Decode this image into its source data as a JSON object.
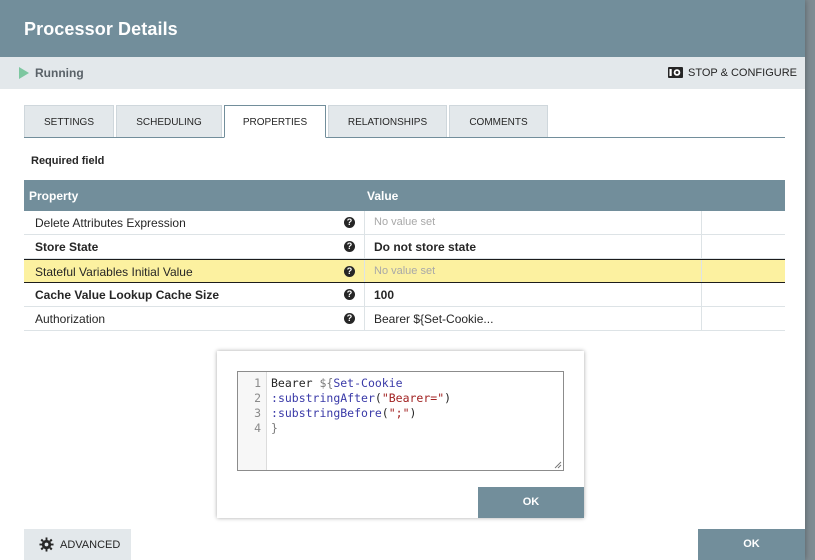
{
  "dialog": {
    "title": "Processor Details"
  },
  "status": {
    "state": "Running",
    "stop_configure_label": "STOP & CONFIGURE"
  },
  "tabs": [
    {
      "label": "SETTINGS",
      "active": false
    },
    {
      "label": "SCHEDULING",
      "active": false
    },
    {
      "label": "PROPERTIES",
      "active": true
    },
    {
      "label": "RELATIONSHIPS",
      "active": false
    },
    {
      "label": "COMMENTS",
      "active": false
    }
  ],
  "required_label": "Required field",
  "grid": {
    "headers": {
      "property": "Property",
      "value": "Value"
    },
    "rows": [
      {
        "name": "Delete Attributes Expression",
        "value": "No value set",
        "required": false,
        "placeholder": true
      },
      {
        "name": "Store State",
        "value": "Do not store state",
        "required": true,
        "placeholder": false
      },
      {
        "name": "Stateful Variables Initial Value",
        "value": "No value set",
        "required": false,
        "placeholder": true,
        "highlighted": true
      },
      {
        "name": "Cache Value Lookup Cache Size",
        "value": "100",
        "required": true,
        "placeholder": false
      },
      {
        "name": "Authorization",
        "value": "Bearer ${Set-Cookie...",
        "required": false,
        "placeholder": false
      }
    ],
    "help_glyph": "?"
  },
  "editor": {
    "line_numbers": [
      "1",
      "2",
      "3",
      "4"
    ],
    "lines": [
      {
        "plain": "Bearer ",
        "expr_open": "${",
        "ident": "Set-Cookie"
      },
      {
        "colon": ":",
        "fn": "substringAfter",
        "open": "(",
        "str": "\"Bearer=\"",
        "close": ")"
      },
      {
        "colon": ":",
        "fn": "substringBefore",
        "open": "(",
        "str": "\";\"",
        "close": ")"
      },
      {
        "close_brace": "}"
      }
    ],
    "ok_label": "OK"
  },
  "footer": {
    "advanced_label": "ADVANCED",
    "ok_label": "OK"
  },
  "colors": {
    "header": "#728e9b",
    "running": "#7dc7a0",
    "highlight_row": "#fcf1a0"
  },
  "icons": [
    "play-icon",
    "stop-configure-icon",
    "help-icon",
    "gear-icon",
    "resize-handle-icon"
  ]
}
